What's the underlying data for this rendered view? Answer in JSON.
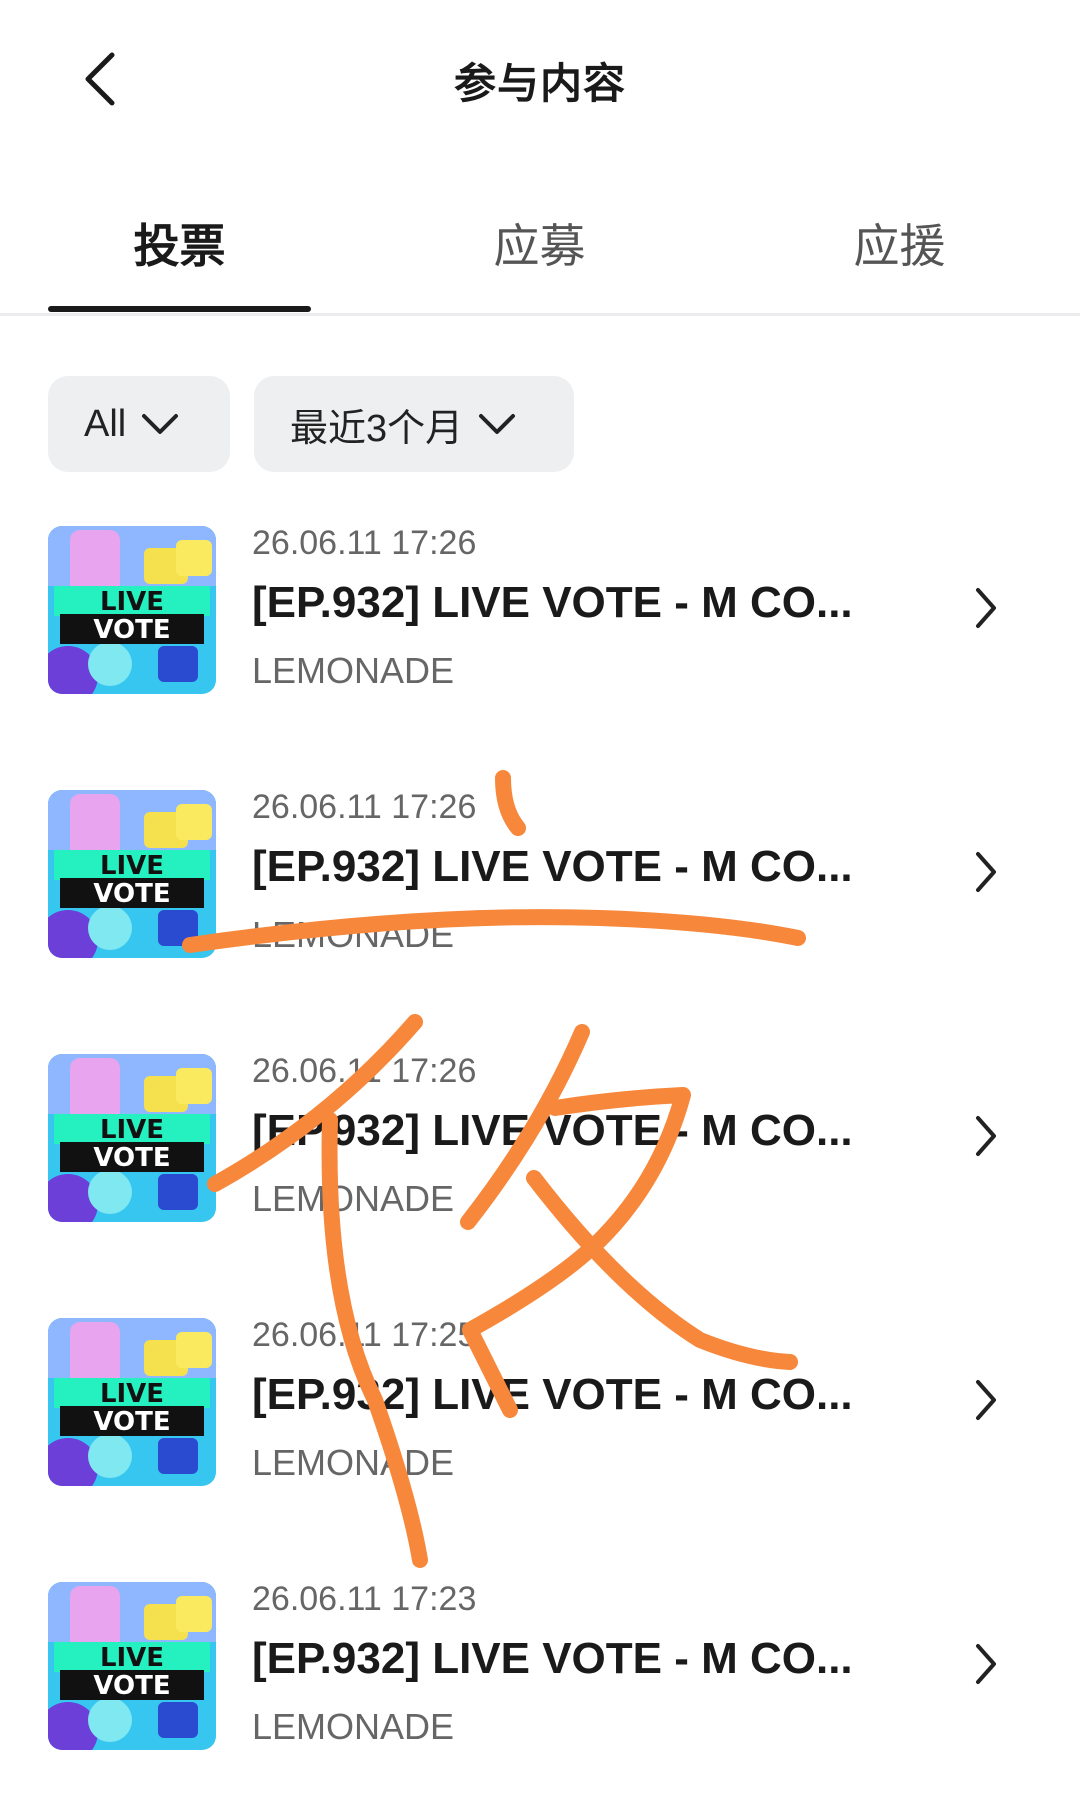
{
  "header": {
    "title": "参与内容"
  },
  "tabs": [
    {
      "label": "投票",
      "active": true
    },
    {
      "label": "应募",
      "active": false
    },
    {
      "label": "应援",
      "active": false
    }
  ],
  "filters": {
    "type": "All",
    "period": "最近3个月"
  },
  "items": [
    {
      "date": "26.06.11 17:26",
      "title": "[EP.932] LIVE VOTE - M CO...",
      "artist": "LEMONADE",
      "thumb_line1": "LIVE",
      "thumb_line2": "VOTE"
    },
    {
      "date": "26.06.11 17:26",
      "title": "[EP.932] LIVE VOTE - M CO...",
      "artist": "LEMONADE",
      "thumb_line1": "LIVE",
      "thumb_line2": "VOTE"
    },
    {
      "date": "26.06.11 17:26",
      "title": "[EP.932] LIVE VOTE - M CO...",
      "artist": "LEMONADE",
      "thumb_line1": "LIVE",
      "thumb_line2": "VOTE"
    },
    {
      "date": "26.06.11 17:25",
      "title": "[EP.932] LIVE VOTE - M CO...",
      "artist": "LEMONADE",
      "thumb_line1": "LIVE",
      "thumb_line2": "VOTE"
    },
    {
      "date": "26.06.11 17:23",
      "title": "[EP.932] LIVE VOTE - M CO...",
      "artist": "LEMONADE",
      "thumb_line1": "LIVE",
      "thumb_line2": "VOTE"
    }
  ],
  "colors": {
    "scribble": "#f7873a",
    "thumb_bg": "#2fd7e0",
    "thumb_band": "#25f0c0"
  },
  "icons": {
    "back": "chevron-left-icon",
    "dropdown": "chevron-down-icon",
    "row": "chevron-right-icon"
  }
}
